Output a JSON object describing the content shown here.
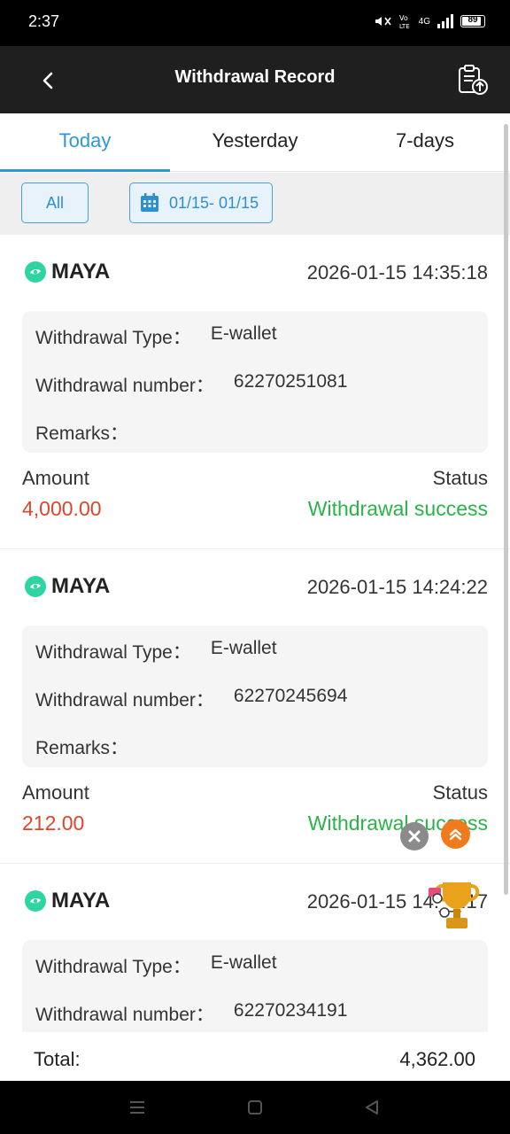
{
  "status_bar": {
    "time": "2:37",
    "network": "4G",
    "battery": "89",
    "battery_level": 0.89
  },
  "header": {
    "title": "Withdrawal Record",
    "back_icon": "chevron-left-icon",
    "right_icon": "clipboard-upload-icon"
  },
  "tabs": [
    {
      "label": "Today",
      "active": true
    },
    {
      "label": "Yesterday",
      "active": false
    },
    {
      "label": "7-days",
      "active": false
    }
  ],
  "filters": {
    "all_label": "All",
    "date_range": "01/15- 01/15",
    "date_icon": "calendar-icon"
  },
  "labels": {
    "withdrawal_type": "Withdrawal Type：",
    "withdrawal_number": "Withdrawal number：",
    "remarks": "Remarks：",
    "amount": "Amount",
    "status": "Status"
  },
  "records": [
    {
      "brand": "MAYA",
      "datetime": "2026-01-15 14:35:18",
      "type": "E-wallet",
      "number": "62270251081",
      "remarks": "",
      "amount": "4,000.00",
      "status": "Withdrawal success"
    },
    {
      "brand": "MAYA",
      "datetime": "2026-01-15 14:24:22",
      "type": "E-wallet",
      "number": "62270245694",
      "remarks": "",
      "amount": "212.00",
      "status": "Withdrawal success"
    },
    {
      "brand": "MAYA",
      "datetime": "2026-01-15 14:__:17",
      "type": "E-wallet",
      "number": "62270234191",
      "remarks": "",
      "amount": "",
      "status": ""
    }
  ],
  "total": {
    "label": "Total:",
    "value": "4,362.00"
  },
  "colors": {
    "accent": "#2d97d8",
    "amount": "#e0442b",
    "success": "#2bb34a",
    "maya": "#2fd5a0",
    "header_bg": "#1f1f1f"
  }
}
